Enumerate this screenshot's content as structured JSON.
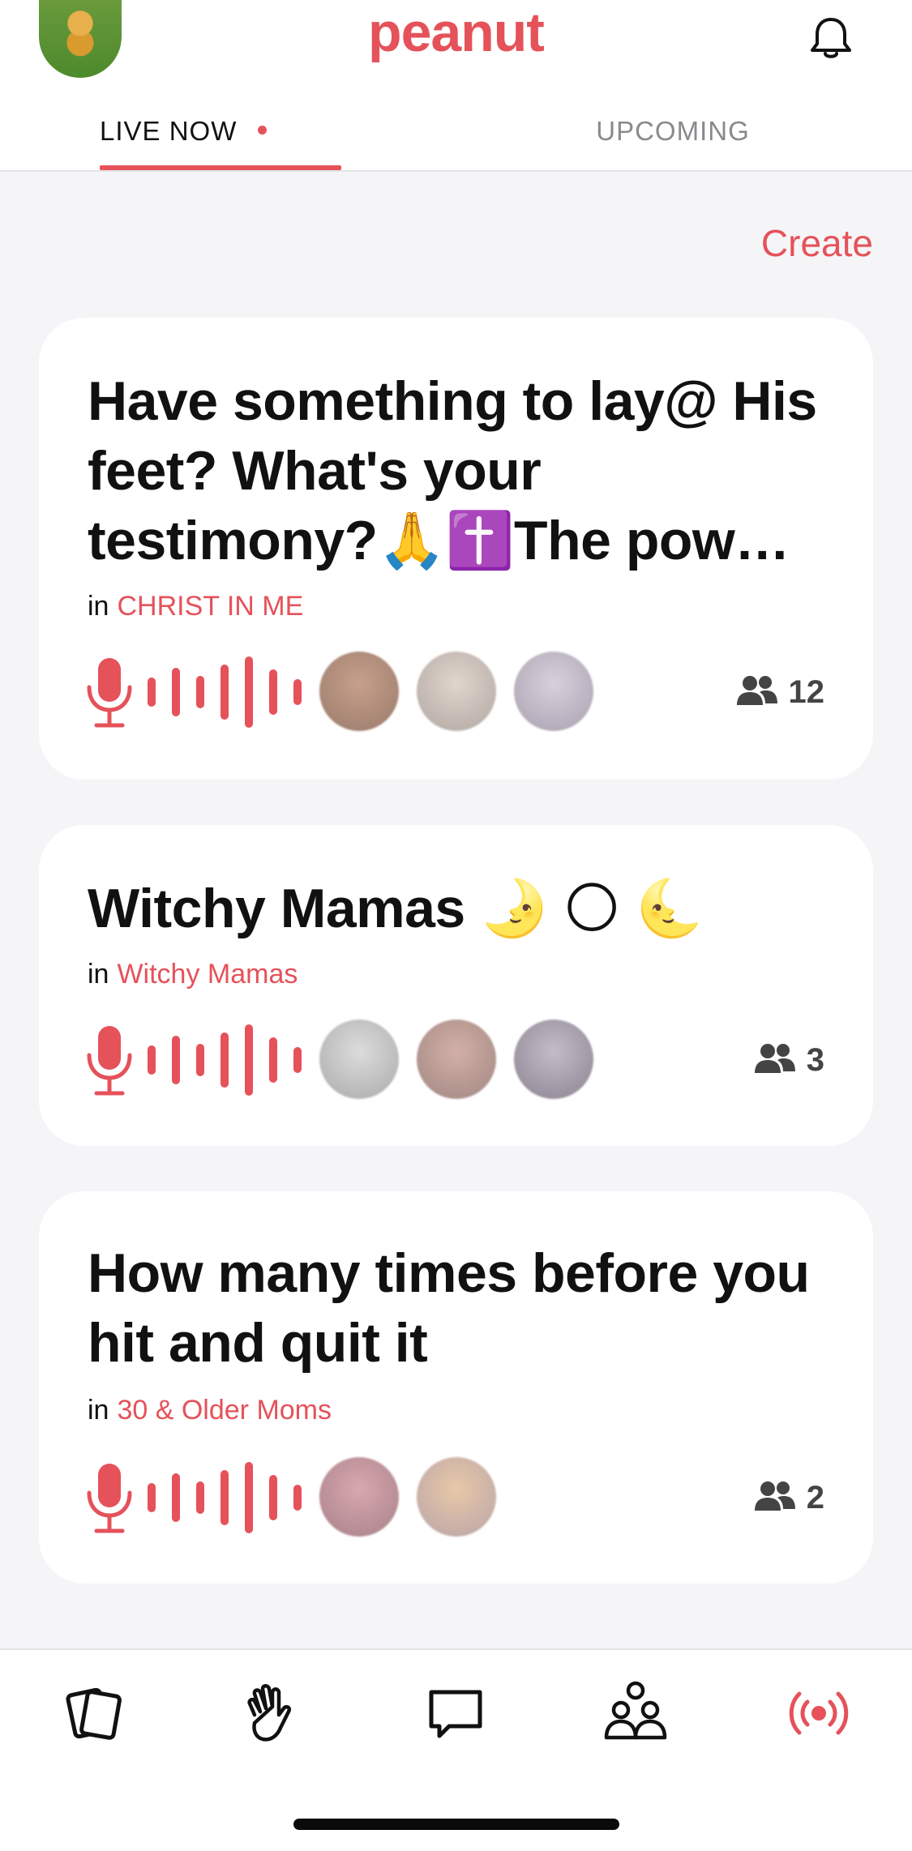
{
  "header": {
    "brand": "peanut",
    "avatar_icon": "profile-avatar",
    "bell_icon": "bell-icon"
  },
  "tabs": {
    "live": "LIVE NOW",
    "upcoming": "UPCOMING",
    "active": "live"
  },
  "actions": {
    "create": "Create"
  },
  "rooms": [
    {
      "title": "Have something to lay@ His feet? What's your testimony?🙏✝️The pow…",
      "in_label": "in",
      "group": "CHRIST IN ME",
      "listeners": "12",
      "avatars": 3
    },
    {
      "title": "Witchy Mamas 🌛 🌕 🌜",
      "in_label": "in",
      "group": "Witchy Mamas",
      "listeners": "3",
      "avatars": 3
    },
    {
      "title": "How many times before you hit and quit it",
      "in_label": "in",
      "group": "30 & Older Moms",
      "listeners": "2",
      "avatars": 2
    }
  ],
  "bottom_nav": [
    {
      "icon": "cards-icon",
      "active": false
    },
    {
      "icon": "wave-hand-icon",
      "active": false
    },
    {
      "icon": "chat-bubble-icon",
      "active": false
    },
    {
      "icon": "community-icon",
      "active": false
    },
    {
      "icon": "live-broadcast-icon",
      "active": true
    }
  ],
  "colors": {
    "accent": "#e5525a",
    "background": "#f5f5f7",
    "card": "#ffffff",
    "muted": "#8a8a8e"
  }
}
